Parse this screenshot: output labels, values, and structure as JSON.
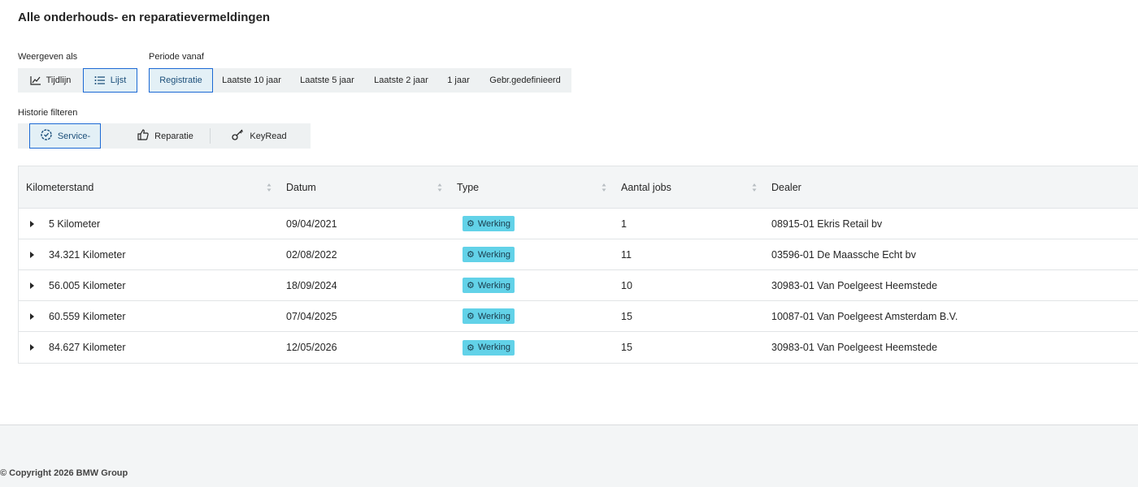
{
  "header": {
    "title": "Alle onderhouds- en reparatievermeldingen"
  },
  "view": {
    "label": "Weergeven als",
    "options": [
      {
        "label": "Tijdlijn",
        "icon": "line-chart-icon",
        "active": false
      },
      {
        "label": "Lijst",
        "icon": "list-icon",
        "active": true
      }
    ]
  },
  "period": {
    "label": "Periode vanaf",
    "options": [
      {
        "label": "Registratie",
        "active": true
      },
      {
        "label": "Laatste 10 jaar",
        "active": false
      },
      {
        "label": "Laatste 5 jaar",
        "active": false
      },
      {
        "label": "Laatste 2 jaar",
        "active": false
      },
      {
        "label": "1 jaar",
        "active": false
      },
      {
        "label": "Gebr.gedefinieerd",
        "active": false
      }
    ]
  },
  "history_filter": {
    "label": "Historie filteren",
    "options": [
      {
        "label": "Service-",
        "icon": "service-gear-icon",
        "active": true
      },
      {
        "label": "Reparatie",
        "icon": "thumbs-up-icon",
        "active": false
      },
      {
        "label": "KeyRead",
        "icon": "key-icon",
        "active": false
      }
    ]
  },
  "table": {
    "columns": [
      "Kilometerstand",
      "Datum",
      "Type",
      "Aantal jobs",
      "Dealer"
    ],
    "rows": [
      {
        "km": "5 Kilometer",
        "date": "09/04/2021",
        "type": "Werking",
        "jobs": "1",
        "dealer": "08915-01 Ekris Retail bv"
      },
      {
        "km": "34.321 Kilometer",
        "date": "02/08/2022",
        "type": "Werking",
        "jobs": "11",
        "dealer": "03596-01 De Maassche Echt bv"
      },
      {
        "km": "56.005 Kilometer",
        "date": "18/09/2024",
        "type": "Werking",
        "jobs": "10",
        "dealer": "30983-01 Van Poelgeest Heemstede"
      },
      {
        "km": "60.559 Kilometer",
        "date": "07/04/2025",
        "type": "Werking",
        "jobs": "15",
        "dealer": "10087-01 Van Poelgeest Amsterdam B.V."
      },
      {
        "km": "84.627 Kilometer",
        "date": "12/05/2026",
        "type": "Werking",
        "jobs": "15",
        "dealer": "30983-01 Van Poelgeest Heemstede"
      }
    ]
  },
  "footer": {
    "copyright": "© Copyright 2026 BMW Group"
  },
  "colors": {
    "accent": "#1c69d4",
    "badge": "#62d2e8",
    "panel": "#eef1f2"
  }
}
